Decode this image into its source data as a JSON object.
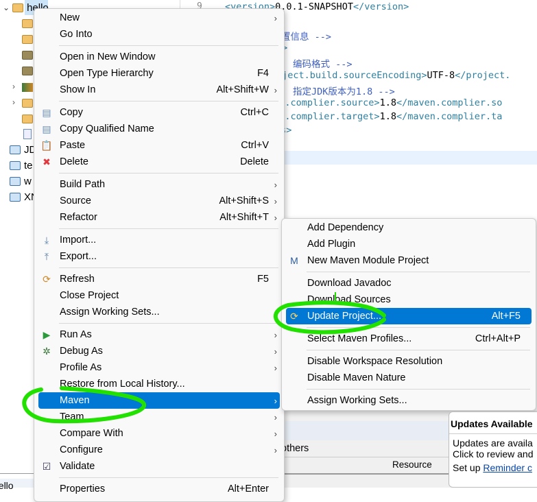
{
  "tree": {
    "project": "hello",
    "items": [
      "JD",
      "te",
      "w",
      "XN"
    ],
    "bottom": "hello"
  },
  "editor": {
    "line_number": "9",
    "lines": [
      {
        "pre": "<version>",
        "val": "0.0.1-SNAPSHOT",
        "post": "</version>"
      },
      {
        "comment": "的配置信息 -->"
      },
      {
        "tag": "s>"
      },
      {
        "comment": "编码格式 -->"
      },
      {
        "pre": "oject.build.sourceEncoding>",
        "val": "UTF-8",
        "post": "</project."
      },
      {
        "comment": "指定JDK版本为1.8 -->"
      },
      {
        "pre": "ven.complier.source>",
        "val": "1.8",
        "post": "</maven.complier.so"
      },
      {
        "pre": "ven.complier.target>",
        "val": "1.8",
        "post": "</maven.complier.ta"
      },
      {
        "tag": "es>"
      }
    ]
  },
  "panel": {
    "tab": "others",
    "column": "Resource"
  },
  "context_menu": {
    "items": [
      {
        "label": "New",
        "arrow": true
      },
      {
        "label": "Go Into"
      },
      {
        "label": "Open in New Window"
      },
      {
        "label": "Open Type Hierarchy",
        "shortcut": "F4"
      },
      {
        "label": "Show In",
        "shortcut": "Alt+Shift+W",
        "arrow": true
      },
      {
        "label": "Copy",
        "shortcut": "Ctrl+C",
        "icon": "copy-icon"
      },
      {
        "label": "Copy Qualified Name",
        "icon": "copy-qualified-icon"
      },
      {
        "label": "Paste",
        "shortcut": "Ctrl+V",
        "icon": "paste-icon"
      },
      {
        "label": "Delete",
        "shortcut": "Delete",
        "icon": "delete-icon"
      },
      {
        "label": "Build Path",
        "arrow": true
      },
      {
        "label": "Source",
        "shortcut": "Alt+Shift+S",
        "arrow": true
      },
      {
        "label": "Refactor",
        "shortcut": "Alt+Shift+T",
        "arrow": true
      },
      {
        "label": "Import...",
        "icon": "import-icon"
      },
      {
        "label": "Export...",
        "icon": "export-icon"
      },
      {
        "label": "Refresh",
        "shortcut": "F5",
        "icon": "refresh-icon"
      },
      {
        "label": "Close Project"
      },
      {
        "label": "Assign Working Sets..."
      },
      {
        "label": "Run As",
        "arrow": true,
        "icon": "run-icon"
      },
      {
        "label": "Debug As",
        "arrow": true,
        "icon": "debug-icon"
      },
      {
        "label": "Profile As",
        "arrow": true
      },
      {
        "label": "Restore from Local History..."
      },
      {
        "label": "Maven",
        "arrow": true,
        "selected": true
      },
      {
        "label": "Team",
        "arrow": true
      },
      {
        "label": "Compare With",
        "arrow": true
      },
      {
        "label": "Configure",
        "arrow": true
      },
      {
        "label": "Validate",
        "icon": "checkbox-checked-icon"
      },
      {
        "label": "Properties",
        "shortcut": "Alt+Enter"
      }
    ]
  },
  "maven_submenu": {
    "items": [
      {
        "label": "Add Dependency"
      },
      {
        "label": "Add Plugin"
      },
      {
        "label": "New Maven Module Project",
        "icon": "maven-module-icon"
      },
      {
        "label": "Download Javadoc"
      },
      {
        "label": "Download Sources"
      },
      {
        "label": "Update Project...",
        "shortcut": "Alt+F5",
        "icon": "update-project-icon",
        "selected": true
      },
      {
        "label": "Select Maven Profiles...",
        "shortcut": "Ctrl+Alt+P"
      },
      {
        "label": "Disable Workspace Resolution"
      },
      {
        "label": "Disable Maven Nature"
      },
      {
        "label": "Assign Working Sets..."
      }
    ]
  },
  "notification": {
    "title": "Updates Available",
    "line1": "Updates are availa",
    "line2": "Click to review and",
    "line3_prefix": "Set up ",
    "link": "Reminder c"
  },
  "colors": {
    "selection": "#0078d4",
    "annotation": "#22e000"
  }
}
